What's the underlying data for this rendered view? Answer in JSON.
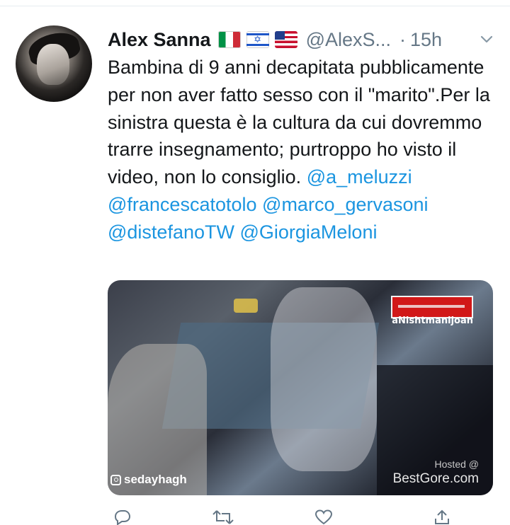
{
  "tweet": {
    "display_name": "Alex Sanna",
    "handle": "@AlexS...",
    "separator": "·",
    "time": "15h",
    "flags": [
      "italy-flag",
      "israel-flag",
      "usa-flag"
    ],
    "text_plain": "Bambina di 9 anni decapitata pubblicamente per non aver fatto sesso con il \"marito\".Per la sinistra questa è la cultura da cui dovremmo trarre insegnamento; purtroppo ho visto il video, non lo consiglio.",
    "mentions": [
      "@a_meluzzi",
      "@francescatotolo",
      "@marco_gervasoni",
      "@distefanoTW",
      "@GiorgiaMeloni"
    ]
  },
  "media": {
    "watermark_top": "aNishtmanijoan",
    "instagram_handle": "sedayhagh",
    "hosted_label": "Hosted @",
    "hosted_site": "BestGore.com"
  },
  "colors": {
    "link": "#1b95e0",
    "text": "#14171a",
    "muted": "#657786"
  },
  "icons": {
    "more": "chevron-down-icon",
    "reply": "reply-icon",
    "retweet": "retweet-icon",
    "like": "heart-icon",
    "share": "share-icon"
  }
}
